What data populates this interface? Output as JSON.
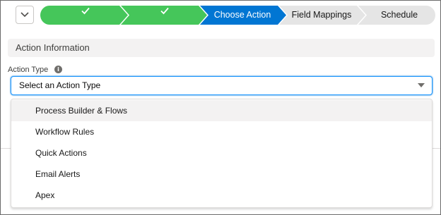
{
  "path": {
    "steps": [
      {
        "label": "",
        "state": "complete",
        "icon": "check-icon"
      },
      {
        "label": "",
        "state": "complete",
        "icon": "check-icon"
      },
      {
        "label": "Choose Action",
        "state": "current"
      },
      {
        "label": "Field Mappings",
        "state": "incomplete"
      },
      {
        "label": "Schedule",
        "state": "incomplete"
      }
    ],
    "toggle_icon": "chevron-down-icon"
  },
  "section": {
    "title": "Action Information"
  },
  "action_type": {
    "label": "Action Type",
    "info_icon": "info-icon",
    "value": "Select an Action Type",
    "options": [
      "Process Builder & Flows",
      "Workflow Rules",
      "Quick Actions",
      "Email Alerts",
      "Apex"
    ],
    "highlighted_index": 0
  },
  "colors": {
    "complete": "#45c65a",
    "current": "#0176d3",
    "incomplete": "#e5e5e5",
    "focus_border": "#1b96ff"
  }
}
